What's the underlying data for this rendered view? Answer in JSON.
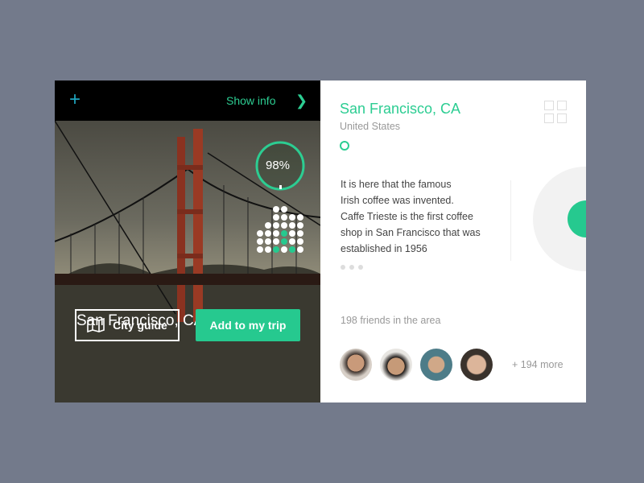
{
  "topbar": {
    "add_icon": "plus-icon",
    "show_info": "Show info",
    "chevron_icon": "chevron-right-icon"
  },
  "photo": {
    "city": "San Francisco, CA",
    "progress_label": "98%",
    "progress": 0.98
  },
  "buttons": {
    "city_guide": "City guide",
    "add_trip": "Add to my trip"
  },
  "info": {
    "title": "San Francisco, CA",
    "country": "United States",
    "description_lines": [
      "It is here that the famous",
      "Irish coffee was invented.",
      "Caffe Trieste is the first coffee",
      "shop in San Francisco that was",
      "established in 1956"
    ],
    "friends": "198 friends in the area",
    "more": "+ 194 more"
  },
  "colors": {
    "accent": "#26c98f",
    "plus": "#1fa5c0"
  }
}
